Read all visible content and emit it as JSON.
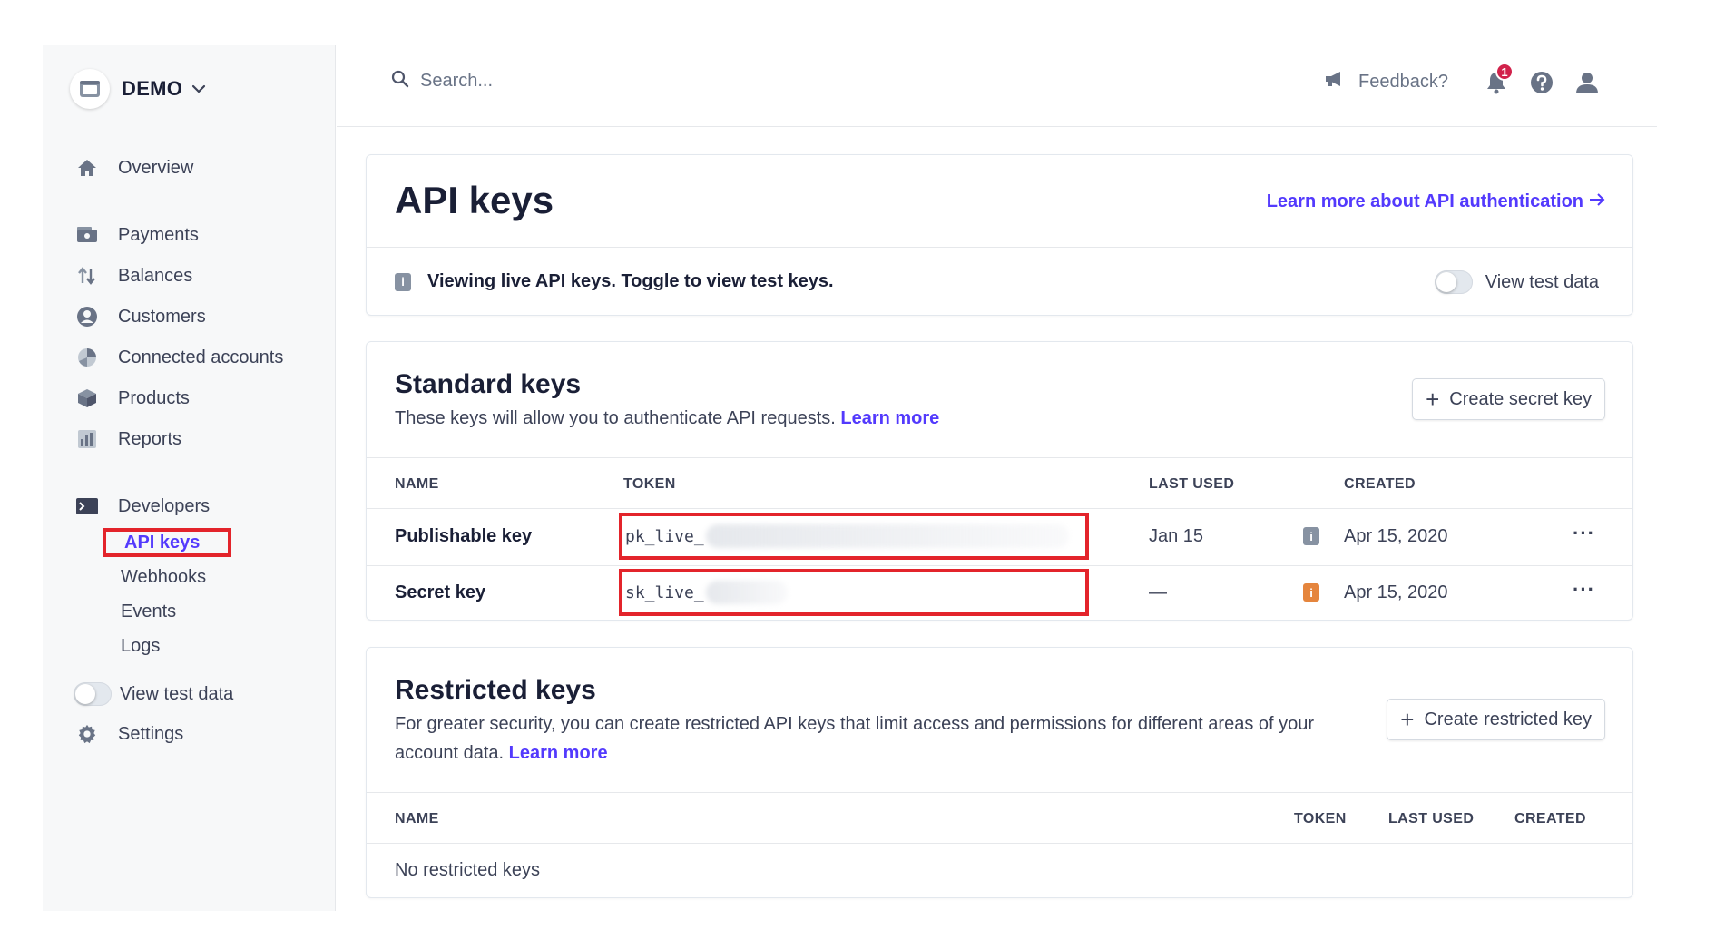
{
  "sidebar": {
    "account": "DEMO",
    "nav": [
      {
        "label": "Overview",
        "icon": "home-icon"
      },
      {
        "label": "Payments",
        "icon": "payments-icon"
      },
      {
        "label": "Balances",
        "icon": "balances-icon"
      },
      {
        "label": "Customers",
        "icon": "customers-icon"
      },
      {
        "label": "Connected accounts",
        "icon": "connected-accounts-icon"
      },
      {
        "label": "Products",
        "icon": "products-icon"
      },
      {
        "label": "Reports",
        "icon": "reports-icon"
      },
      {
        "label": "Developers",
        "icon": "developers-icon"
      }
    ],
    "developer_items": [
      "API keys",
      "Webhooks",
      "Events",
      "Logs"
    ],
    "view_test_data": "View test data",
    "settings": "Settings"
  },
  "topbar": {
    "search_placeholder": "Search...",
    "feedback": "Feedback?",
    "notification_count": "1"
  },
  "header": {
    "title": "API keys",
    "learn_link": "Learn more about API authentication",
    "info": "Viewing live API keys. Toggle to view test keys.",
    "toggle_label": "View test data"
  },
  "standard": {
    "title": "Standard keys",
    "description": "These keys will allow you to authenticate API requests.",
    "learn_more": "Learn more",
    "create_button": "Create secret key",
    "columns": [
      "NAME",
      "TOKEN",
      "LAST USED",
      "CREATED"
    ],
    "rows": [
      {
        "name": "Publishable key",
        "token": "pk_live_",
        "last_used": "Jan 15",
        "created": "Apr 15, 2020",
        "info_color": "#8792a2"
      },
      {
        "name": "Secret key",
        "token": "sk_live_",
        "last_used": "—",
        "created": "Apr 15, 2020",
        "info_color": "#e5853d"
      }
    ]
  },
  "restricted": {
    "title": "Restricted keys",
    "description": "For greater security, you can create restricted API keys that limit access and permissions for different areas of your account data.",
    "learn_more": "Learn more",
    "create_button": "Create restricted key",
    "columns": [
      "NAME",
      "TOKEN",
      "LAST USED",
      "CREATED"
    ],
    "empty": "No restricted keys"
  },
  "colors": {
    "accent": "#533afd",
    "highlight": "#e3242b"
  }
}
